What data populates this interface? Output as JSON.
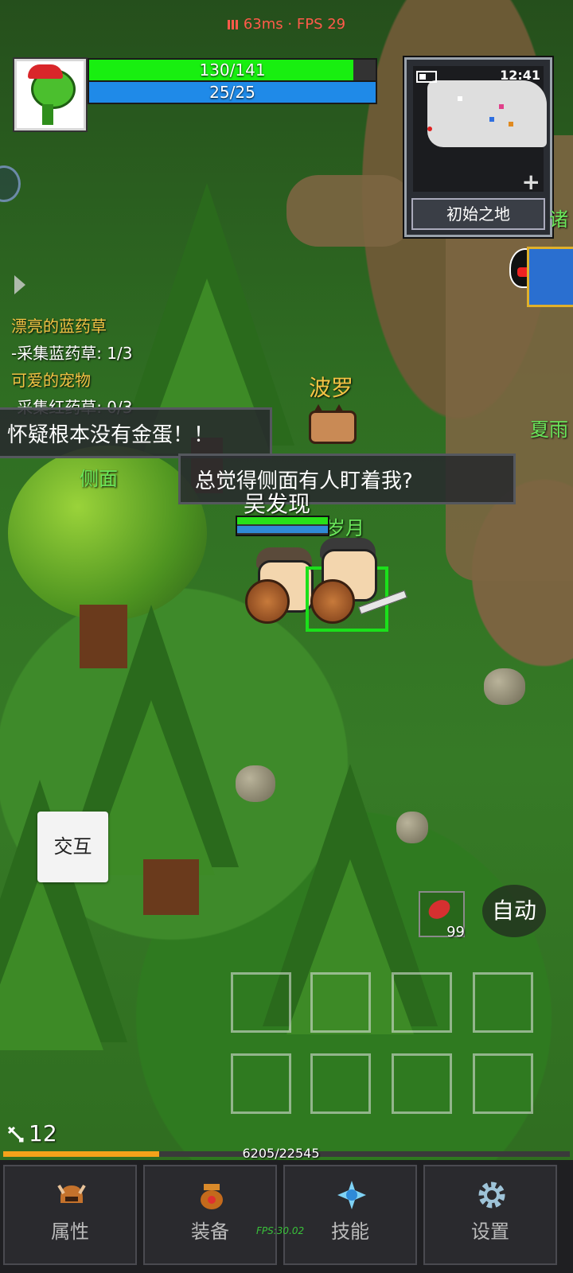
{
  "hud": {
    "ping": "63ms",
    "fps": "FPS 29",
    "hp_text": "130/141",
    "hp_fraction": 0.922,
    "hp_color": "#18ef10",
    "mp_text": "25/25",
    "mp_fraction": 1.0,
    "mp_color": "#1f8ae8"
  },
  "minimap": {
    "time": "12:41",
    "location": "初始之地",
    "zoom_icon": "plus-icon"
  },
  "quests": [
    {
      "title": "漂亮的蓝药草",
      "task": "-采集蓝药草: 1/3"
    },
    {
      "title": "可爱的宠物",
      "task": "-采集红药草: 0/3"
    }
  ],
  "speech": {
    "left": "怀疑根本没有金蛋！！",
    "center": "总觉得侧面有人盯着我?"
  },
  "labels": {
    "pet_name": "波罗",
    "side_label": "侧面",
    "player_name": "吴发现",
    "partner_name": "岁月",
    "npc_right_1": "诸",
    "npc_right_2": "夏雨"
  },
  "player_mini": {
    "hp_fraction": 1.0,
    "mp_fraction": 1.0
  },
  "actions": {
    "interact": "交互",
    "auto": "自动",
    "potion_count": "99",
    "skill_slots": 8
  },
  "progress": {
    "level": "12",
    "exp_text": "6205/22545",
    "exp_fraction": 0.275,
    "exp_color": "#f5a21a"
  },
  "tabs": [
    {
      "label": "属性",
      "icon": "helmet-icon"
    },
    {
      "label": "装备",
      "icon": "bag-icon"
    },
    {
      "label": "技能",
      "icon": "crystal-icon"
    },
    {
      "label": "设置",
      "icon": "gear-icon"
    }
  ],
  "footer": {
    "fps": "FPS:30.02"
  }
}
